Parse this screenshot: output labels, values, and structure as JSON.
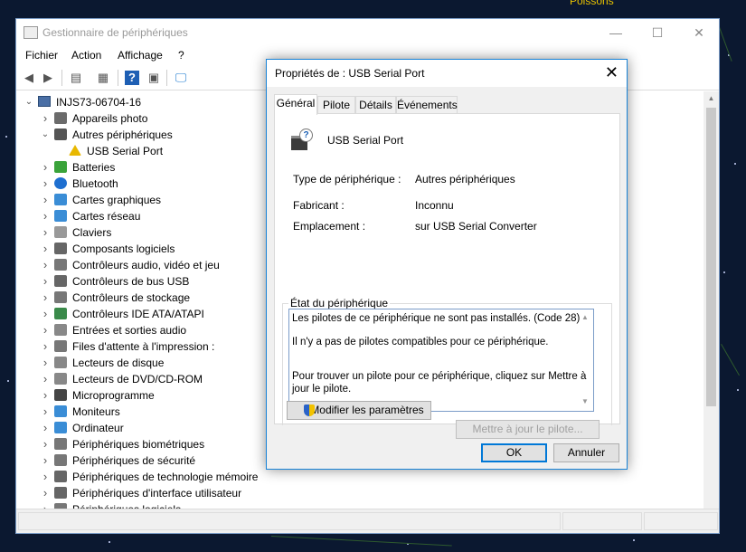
{
  "background": {
    "corner_text": "Poissons"
  },
  "device_manager": {
    "title": "Gestionnaire de périphériques",
    "window_buttons": {
      "minimize": "—",
      "maximize": "☐",
      "close": "✕"
    },
    "menu": [
      "Fichier",
      "Action",
      "Affichage",
      "?"
    ],
    "tree": {
      "root": "INJS73-06704-16",
      "items": [
        {
          "label": "Appareils photo",
          "expanded": false,
          "icon": "camera-icon"
        },
        {
          "label": "Autres périphériques",
          "expanded": true,
          "icon": "unknown-device-icon"
        },
        {
          "label": "USB Serial Port",
          "child": true,
          "icon": "warning-device-icon"
        },
        {
          "label": "Batteries",
          "expanded": false,
          "icon": "battery-icon"
        },
        {
          "label": "Bluetooth",
          "expanded": false,
          "icon": "bluetooth-icon"
        },
        {
          "label": "Cartes graphiques",
          "expanded": false,
          "icon": "display-adapter-icon"
        },
        {
          "label": "Cartes réseau",
          "expanded": false,
          "icon": "network-adapter-icon"
        },
        {
          "label": "Claviers",
          "expanded": false,
          "icon": "keyboard-icon"
        },
        {
          "label": "Composants logiciels",
          "expanded": false,
          "icon": "software-component-icon"
        },
        {
          "label": "Contrôleurs audio, vidéo et jeu",
          "expanded": false,
          "icon": "audio-icon"
        },
        {
          "label": "Contrôleurs de bus USB",
          "expanded": false,
          "icon": "usb-icon"
        },
        {
          "label": "Contrôleurs de stockage",
          "expanded": false,
          "icon": "storage-controller-icon"
        },
        {
          "label": "Contrôleurs IDE ATA/ATAPI",
          "expanded": false,
          "icon": "ide-icon"
        },
        {
          "label": "Entrées et sorties audio",
          "expanded": false,
          "icon": "speaker-icon"
        },
        {
          "label": "Files d'attente à l'impression :",
          "expanded": false,
          "icon": "printer-icon"
        },
        {
          "label": "Lecteurs de disque",
          "expanded": false,
          "icon": "disk-drive-icon"
        },
        {
          "label": "Lecteurs de DVD/CD-ROM",
          "expanded": false,
          "icon": "dvd-icon"
        },
        {
          "label": "Microprogramme",
          "expanded": false,
          "icon": "firmware-icon"
        },
        {
          "label": "Moniteurs",
          "expanded": false,
          "icon": "monitor-icon"
        },
        {
          "label": "Ordinateur",
          "expanded": false,
          "icon": "computer-icon"
        },
        {
          "label": "Périphériques biométriques",
          "expanded": false,
          "icon": "fingerprint-icon"
        },
        {
          "label": "Périphériques de sécurité",
          "expanded": false,
          "icon": "security-device-icon"
        },
        {
          "label": "Périphériques de technologie mémoire",
          "expanded": false,
          "icon": "memory-icon"
        },
        {
          "label": "Périphériques d'interface utilisateur",
          "expanded": false,
          "icon": "hid-icon"
        },
        {
          "label": "Périphériques logiciels",
          "expanded": false,
          "icon": "software-device-icon"
        }
      ]
    }
  },
  "dialog": {
    "title": "Propriétés de : USB Serial Port",
    "close": "✕",
    "tabs": [
      "Général",
      "Pilote",
      "Détails",
      "Événements"
    ],
    "device_name": "USB Serial Port",
    "fields": [
      {
        "label": "Type de périphérique :",
        "value": "Autres périphériques"
      },
      {
        "label": "Fabricant :",
        "value": "Inconnu"
      },
      {
        "label": "Emplacement :",
        "value": "sur USB Serial Converter"
      }
    ],
    "status_group": "État du périphérique",
    "status_lines": [
      "Les pilotes de ce périphérique ne sont pas installés. (Code 28)",
      "Il n'y a pas de pilotes compatibles pour ce périphérique.",
      "Pour trouver un pilote pour ce périphérique, cliquez sur Mettre à",
      "jour le pilote."
    ],
    "update_driver_button": "Mettre à jour le pilote...",
    "change_settings_button": "Modifier les paramètres",
    "ok_button": "OK",
    "cancel_button": "Annuler"
  }
}
